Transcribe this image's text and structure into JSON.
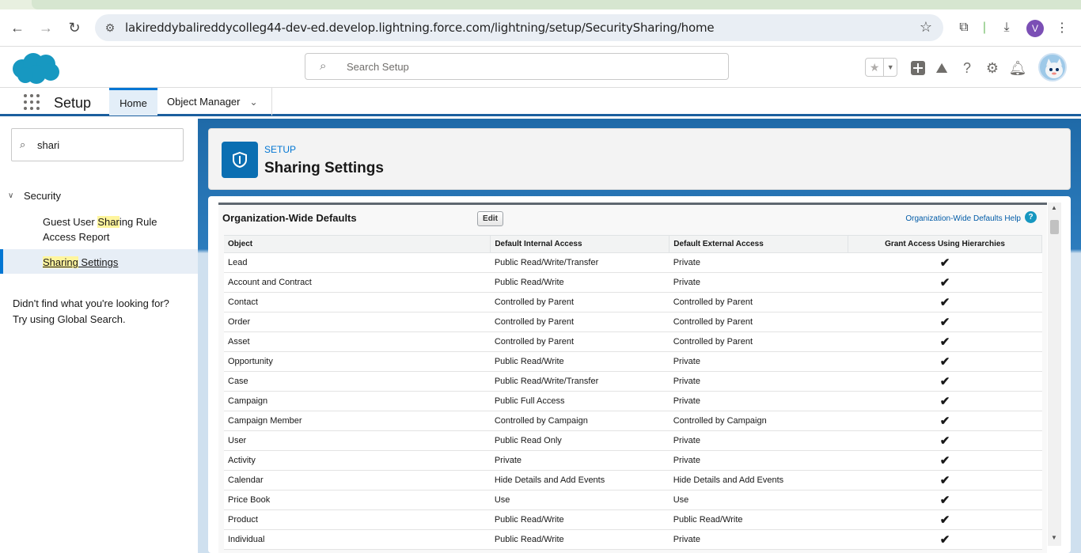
{
  "browser": {
    "url": "lakireddybalireddycolleg44-dev-ed.develop.lightning.force.com/lightning/setup/SecuritySharing/home",
    "profile_initial": "V"
  },
  "header": {
    "search_placeholder": "Search Setup"
  },
  "nav": {
    "app_name": "Setup",
    "tabs": [
      "Home",
      "Object Manager"
    ]
  },
  "sidebar": {
    "quickfind_value": "shari",
    "section": "Security",
    "items": [
      {
        "pre": "Guest User ",
        "match": "Shar",
        "post": "ing Rule Access Report"
      },
      {
        "pre": "",
        "match": "Sharing",
        "post": " Settings"
      }
    ],
    "notfound_line1": "Didn't find what you're looking for?",
    "notfound_line2": "Try using Global Search."
  },
  "page": {
    "eyebrow": "SETUP",
    "title": "Sharing Settings"
  },
  "owd": {
    "title": "Organization-Wide Defaults",
    "edit_label": "Edit",
    "help_label": "Organization-Wide Defaults Help",
    "columns": [
      "Object",
      "Default Internal Access",
      "Default External Access",
      "Grant Access Using Hierarchies"
    ],
    "rows": [
      [
        "Lead",
        "Public Read/Write/Transfer",
        "Private",
        "✔"
      ],
      [
        "Account and Contract",
        "Public Read/Write",
        "Private",
        "✔"
      ],
      [
        "Contact",
        "Controlled by Parent",
        "Controlled by Parent",
        "✔"
      ],
      [
        "Order",
        "Controlled by Parent",
        "Controlled by Parent",
        "✔"
      ],
      [
        "Asset",
        "Controlled by Parent",
        "Controlled by Parent",
        "✔"
      ],
      [
        "Opportunity",
        "Public Read/Write",
        "Private",
        "✔"
      ],
      [
        "Case",
        "Public Read/Write/Transfer",
        "Private",
        "✔"
      ],
      [
        "Campaign",
        "Public Full Access",
        "Private",
        "✔"
      ],
      [
        "Campaign Member",
        "Controlled by Campaign",
        "Controlled by Campaign",
        "✔"
      ],
      [
        "User",
        "Public Read Only",
        "Private",
        "✔"
      ],
      [
        "Activity",
        "Private",
        "Private",
        "✔"
      ],
      [
        "Calendar",
        "Hide Details and Add Events",
        "Hide Details and Add Events",
        "✔"
      ],
      [
        "Price Book",
        "Use",
        "Use",
        "✔"
      ],
      [
        "Product",
        "Public Read/Write",
        "Public Read/Write",
        "✔"
      ],
      [
        "Individual",
        "Public Read/Write",
        "Private",
        "✔"
      ]
    ]
  }
}
